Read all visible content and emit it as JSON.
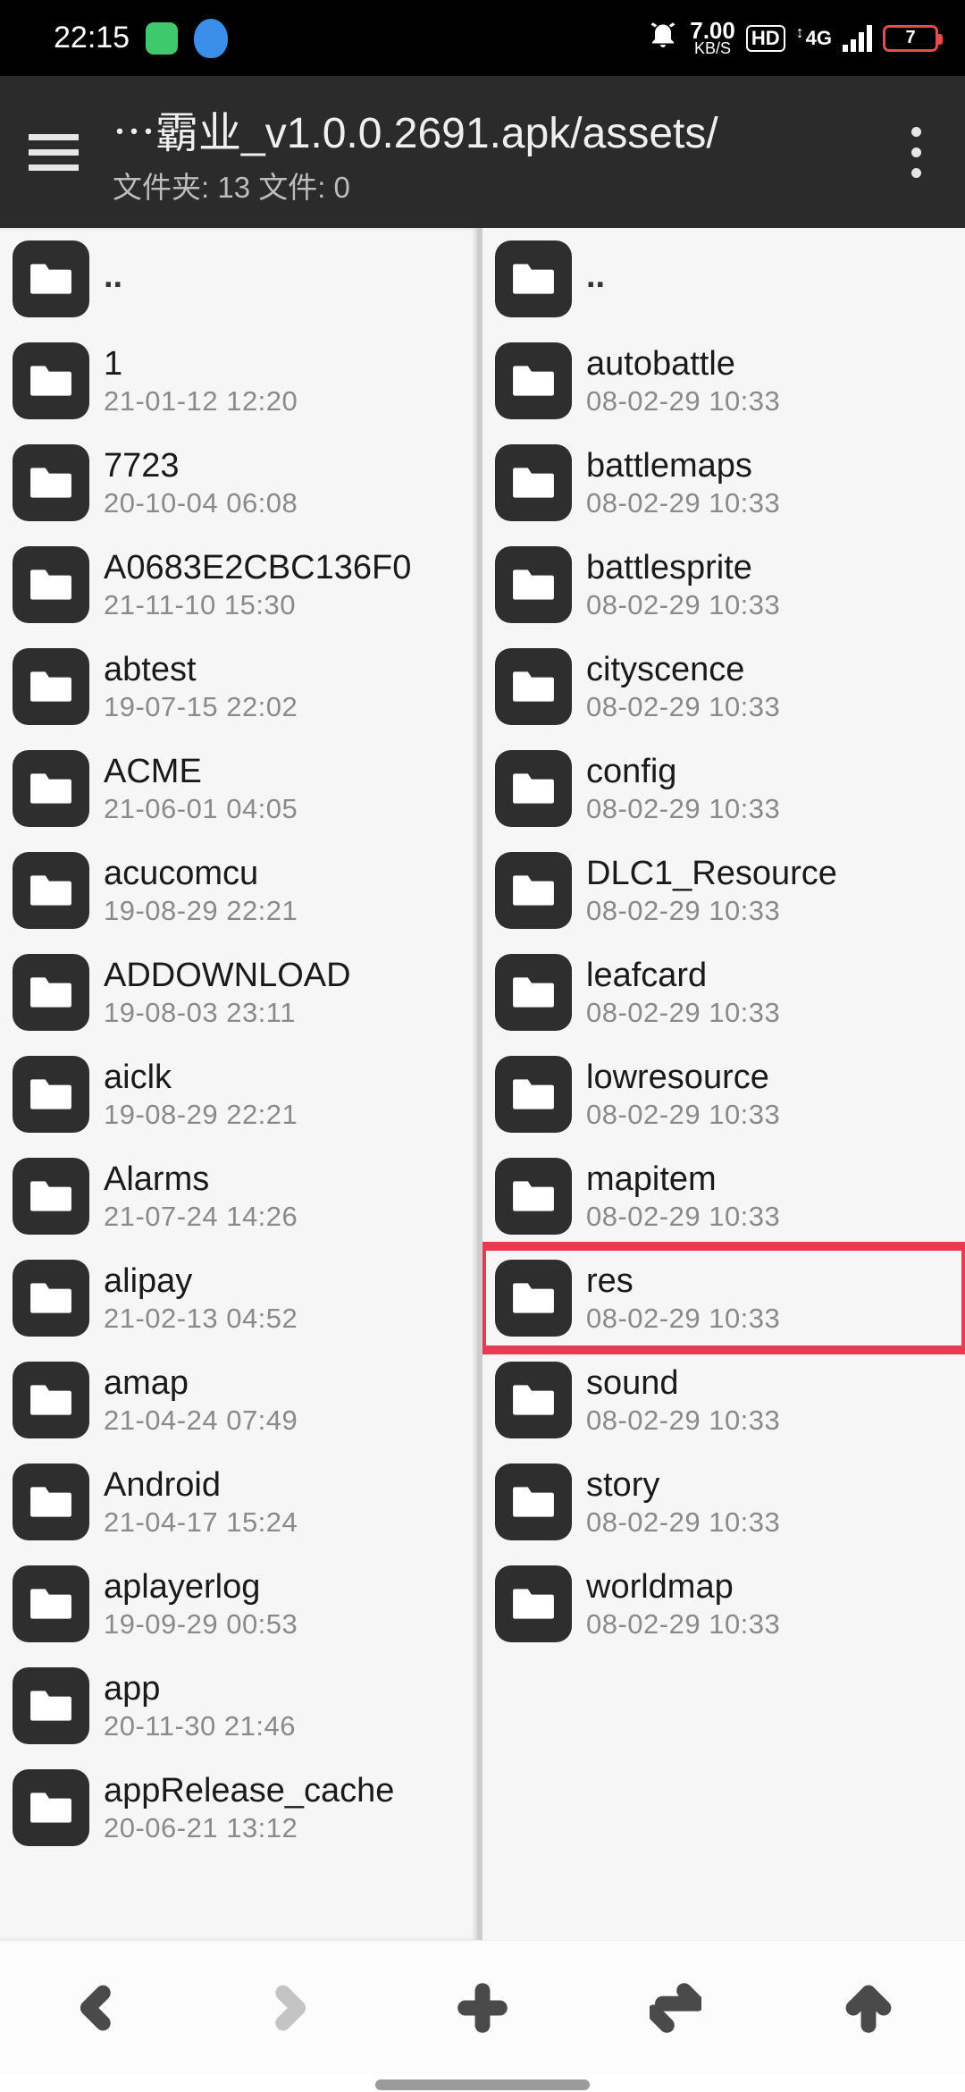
{
  "status": {
    "time": "22:15",
    "speed_value": "7.00",
    "speed_unit": "KB/S",
    "hd": "HD",
    "net": "4G",
    "battery": "7"
  },
  "appbar": {
    "title": "⋯霸业_v1.0.0.2691.apk/assets/",
    "subtitle": "文件夹: 13  文件: 0"
  },
  "left_pane": [
    {
      "name": "..",
      "date": "",
      "up": true
    },
    {
      "name": "1",
      "date": "21-01-12 12:20"
    },
    {
      "name": "7723",
      "date": "20-10-04 06:08"
    },
    {
      "name": "A0683E2CBC136F0",
      "date": "21-11-10 15:30"
    },
    {
      "name": "abtest",
      "date": "19-07-15 22:02"
    },
    {
      "name": "ACME",
      "date": "21-06-01 04:05"
    },
    {
      "name": "acucomcu",
      "date": "19-08-29 22:21"
    },
    {
      "name": "ADDOWNLOAD",
      "date": "19-08-03 23:11"
    },
    {
      "name": "aiclk",
      "date": "19-08-29 22:21"
    },
    {
      "name": "Alarms",
      "date": "21-07-24 14:26"
    },
    {
      "name": "alipay",
      "date": "21-02-13 04:52"
    },
    {
      "name": "amap",
      "date": "21-04-24 07:49"
    },
    {
      "name": "Android",
      "date": "21-04-17 15:24"
    },
    {
      "name": "aplayerlog",
      "date": "19-09-29 00:53"
    },
    {
      "name": "app",
      "date": "20-11-30 21:46"
    },
    {
      "name": "appRelease_cache",
      "date": "20-06-21 13:12"
    }
  ],
  "right_pane": [
    {
      "name": "..",
      "date": "",
      "up": true
    },
    {
      "name": "autobattle",
      "date": "08-02-29 10:33"
    },
    {
      "name": "battlemaps",
      "date": "08-02-29 10:33"
    },
    {
      "name": "battlesprite",
      "date": "08-02-29 10:33"
    },
    {
      "name": "cityscence",
      "date": "08-02-29 10:33"
    },
    {
      "name": "config",
      "date": "08-02-29 10:33"
    },
    {
      "name": "DLC1_Resource",
      "date": "08-02-29 10:33"
    },
    {
      "name": "leafcard",
      "date": "08-02-29 10:33"
    },
    {
      "name": "lowresource",
      "date": "08-02-29 10:33"
    },
    {
      "name": "mapitem",
      "date": "08-02-29 10:33"
    },
    {
      "name": "res",
      "date": "08-02-29 10:33",
      "highlight": true
    },
    {
      "name": "sound",
      "date": "08-02-29 10:33"
    },
    {
      "name": "story",
      "date": "08-02-29 10:33"
    },
    {
      "name": "worldmap",
      "date": "08-02-29 10:33"
    }
  ]
}
